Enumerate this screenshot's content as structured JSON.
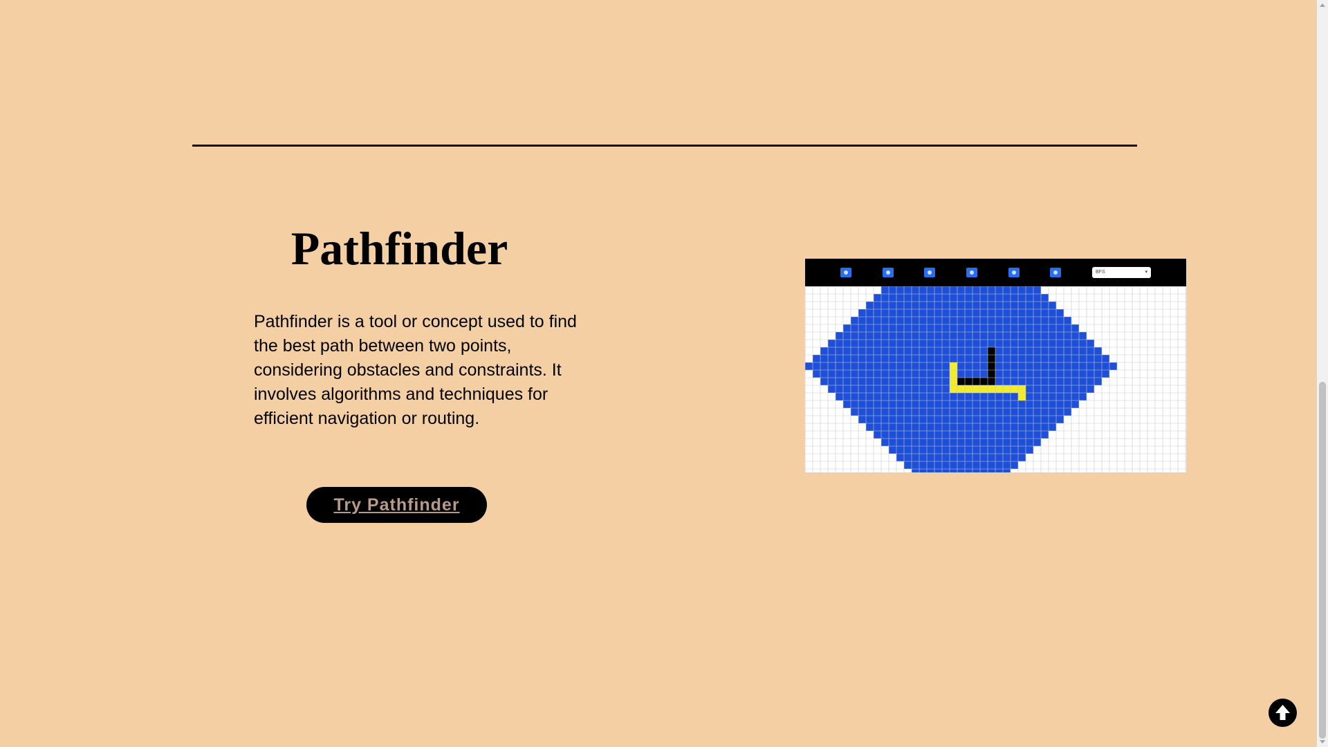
{
  "project": {
    "title": "Pathfinder",
    "description": "Pathfinder is a tool or concept used to find the best path between two points, considering obstacles and constraints. It involves algorithms and techniques for efficient navigation or routing.",
    "cta_label": "Try Pathfinder"
  },
  "preview": {
    "toolbar_select_value": "BFS",
    "toolbar_icons": [
      "start-node-icon",
      "end-node-icon",
      "wall-icon",
      "weight-icon",
      "clear-icon",
      "play-icon"
    ]
  },
  "colors": {
    "background": "#f5cfa4",
    "button_bg": "#000000",
    "button_text": "#b89a88",
    "visited": "#1e4fd8",
    "path": "#f2ec2b",
    "wall": "#000000",
    "grid_line": "#c9c9c9"
  },
  "scroll_top": {
    "icon": "arrow-up-icon"
  }
}
